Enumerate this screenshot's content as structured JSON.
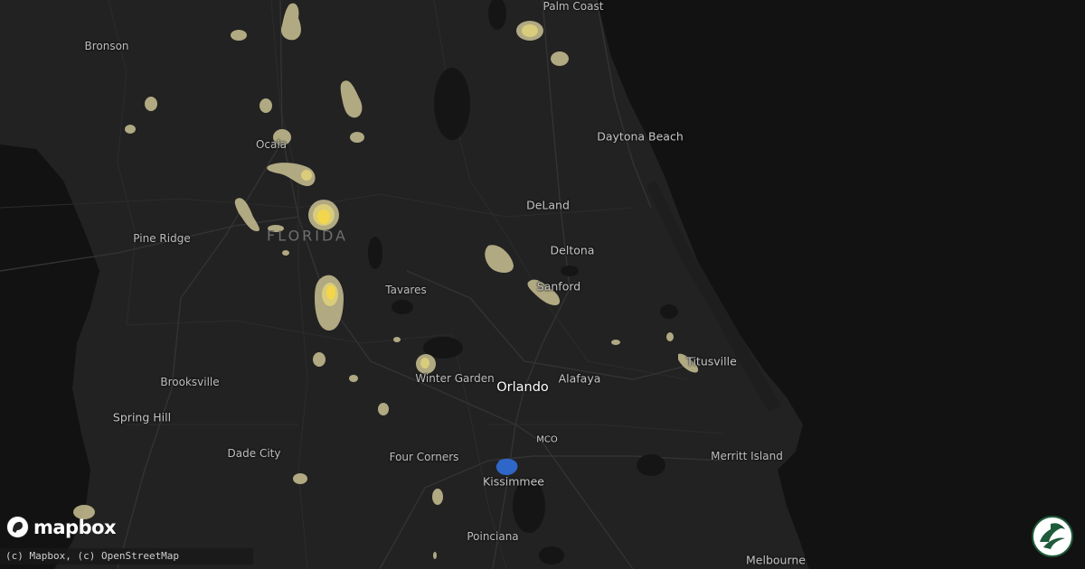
{
  "map": {
    "state_label": "FLORIDA",
    "cities": [
      {
        "key": "palm-coast",
        "label": "Palm Coast"
      },
      {
        "key": "bronson",
        "label": "Bronson"
      },
      {
        "key": "ocala",
        "label": "Ocala"
      },
      {
        "key": "daytona-beach",
        "label": "Daytona Beach"
      },
      {
        "key": "deland",
        "label": "DeLand"
      },
      {
        "key": "pine-ridge",
        "label": "Pine Ridge"
      },
      {
        "key": "deltona",
        "label": "Deltona"
      },
      {
        "key": "sanford",
        "label": "Sanford"
      },
      {
        "key": "tavares",
        "label": "Tavares"
      },
      {
        "key": "titusville",
        "label": "Titusville"
      },
      {
        "key": "brooksville",
        "label": "Brooksville"
      },
      {
        "key": "winter-garden",
        "label": "Winter Garden"
      },
      {
        "key": "alafaya",
        "label": "Alafaya"
      },
      {
        "key": "orlando",
        "label": "Orlando"
      },
      {
        "key": "spring-hill",
        "label": "Spring Hill"
      },
      {
        "key": "dade-city",
        "label": "Dade City"
      },
      {
        "key": "four-corners",
        "label": "Four Corners"
      },
      {
        "key": "merritt-island",
        "label": "Merritt Island"
      },
      {
        "key": "kissimmee",
        "label": "Kissimmee"
      },
      {
        "key": "poinciana",
        "label": "Poinciana"
      },
      {
        "key": "melbourne",
        "label": "Melbourne"
      }
    ],
    "airport": "MCO",
    "overlay_colors": {
      "low": "#c9c193",
      "mid": "#d9cc7a",
      "high": "#f3d64b",
      "marker": "#2f67c8",
      "ocean": "#121212",
      "land": "#222222"
    }
  },
  "branding": {
    "logo_text": "mapbox",
    "attribution": "(c) Mapbox, (c) OpenStreetMap",
    "logo_icon": "mapbox-logo-icon",
    "corner_icon": "circular-swirl-logo-icon"
  }
}
